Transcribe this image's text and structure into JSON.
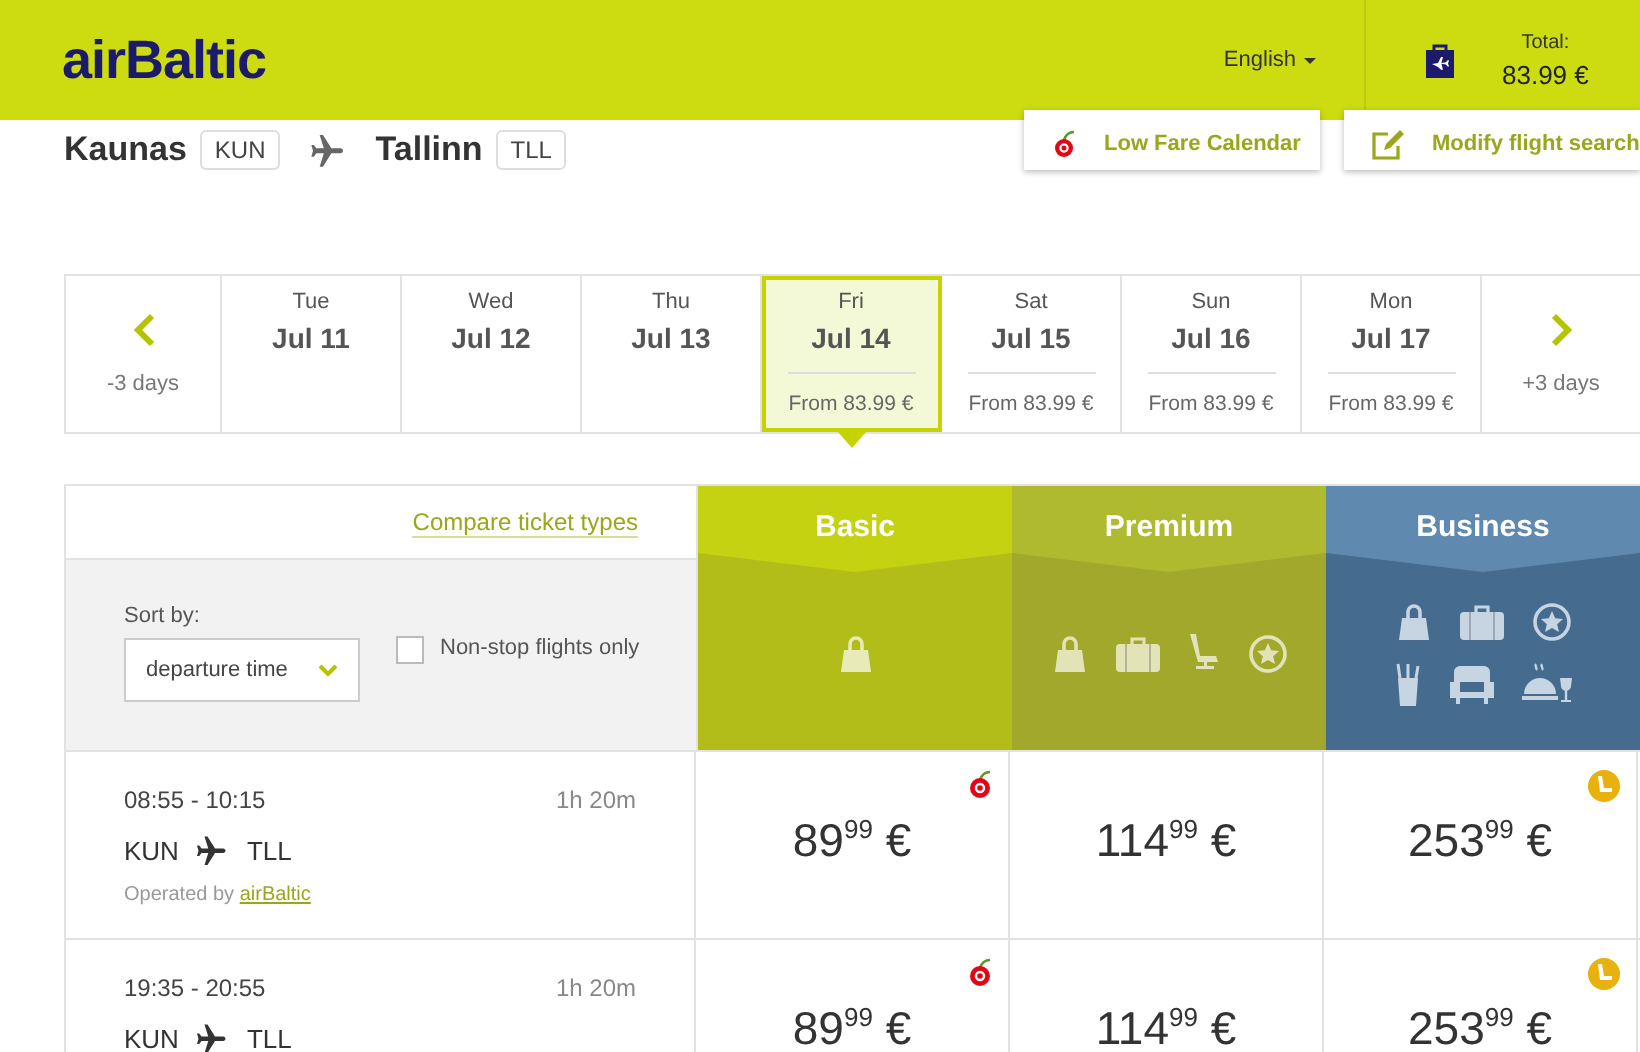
{
  "header": {
    "logo": "airBaltic",
    "language": "English",
    "cart": {
      "label": "Total:",
      "amount": "83.99 €"
    }
  },
  "route": {
    "origin": "Kaunas",
    "origin_code": "KUN",
    "destination": "Tallinn",
    "destination_code": "TLL"
  },
  "actions": [
    {
      "kind": "calendar",
      "label": "Low Fare Calendar"
    },
    {
      "kind": "edit",
      "label": "Modify flight search"
    }
  ],
  "dates": {
    "previous": "-3 days",
    "next": "+3 days",
    "days": [
      {
        "weekday": "Tue",
        "date": "Jul 11",
        "selected": false
      },
      {
        "weekday": "Wed",
        "date": "Jul 12",
        "selected": false
      },
      {
        "weekday": "Thu",
        "date": "Jul 13",
        "selected": false
      },
      {
        "weekday": "Fri",
        "date": "Jul 14",
        "price": "From 83.99 €",
        "selected": true
      },
      {
        "weekday": "Sat",
        "date": "Jul 15",
        "price": "From 83.99 €",
        "selected": false
      },
      {
        "weekday": "Sun",
        "date": "Jul 16",
        "price": "From 83.99 €",
        "selected": false
      },
      {
        "weekday": "Mon",
        "date": "Jul 17",
        "price": "From 83.99 €",
        "selected": false
      }
    ]
  },
  "fares": {
    "compare_link": "Compare ticket types",
    "sort_label": "Sort by:",
    "sort_value": "departure time",
    "nonstop": {
      "label": "Non-stop flights only",
      "checked": false
    },
    "classes": [
      {
        "kind": "basic",
        "name": "Basic"
      },
      {
        "kind": "premium",
        "name": "Premium"
      },
      {
        "kind": "business",
        "name": "Business"
      }
    ]
  },
  "flights": [
    {
      "times": "08:55 - 10:15",
      "duration": "1h 20m",
      "origin": "KUN",
      "destination": "TLL",
      "operated_by": "Operated by",
      "operator": "airBaltic",
      "prices": [
        {
          "amount": "89$^{99}$ €",
          "kind": "ecom"
        },
        {
          "amount": "114$^{99}$ €",
          "kind": "plain"
        },
        {
          "amount": "253$^{99}$ €",
          "kind": "lounge"
        }
      ]
    },
    {
      "times": "19:35 - 20:55",
      "duration": "1h 20m",
      "origin": "KUN",
      "destination": "TLL",
      "prices": [
        {
          "amount": "89$^{99}$ €",
          "kind": "ecom"
        },
        {
          "amount": "114$^{99}$ €",
          "kind": "plain"
        },
        {
          "amount": "253$^{99}$ €",
          "kind": "lounge"
        }
      ]
    }
  ]
}
